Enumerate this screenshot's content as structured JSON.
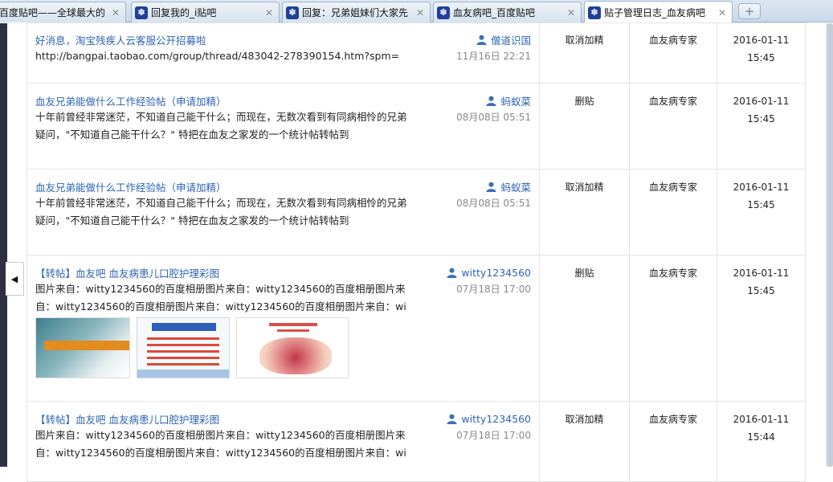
{
  "tabs": [
    {
      "title": "百度贴吧——全球最大的",
      "close": "✕",
      "icon": "none",
      "active": false
    },
    {
      "title": "回复我的_i贴吧",
      "close": "✕",
      "icon": "paw-icon",
      "active": false
    },
    {
      "title": "回复：兄弟姐妹们大家先",
      "close": "✕",
      "icon": "paw-icon",
      "active": false
    },
    {
      "title": "血友病吧_百度贴吧",
      "close": "✕",
      "icon": "paw-icon",
      "active": false
    },
    {
      "title": "贴子管理日志_血友病吧",
      "close": "✕",
      "icon": "paw-icon",
      "active": true
    }
  ],
  "new_tab_label": "+",
  "collapse_glyph": "◀",
  "user_icon": "user-icon",
  "rows": [
    {
      "title": "好消息，淘宝残疾人云客服公开招募啦",
      "author": "僧道识国",
      "excerpt": "http://bangpai.taobao.com/group/thread/483042-278390154.htm?spm=",
      "date": "11月16日 22:21",
      "operation": "取消加精",
      "operator": "血友病专家",
      "op_date": "2016-01-11",
      "op_time": "15:45"
    },
    {
      "title": "血友兄弟能做什么工作经验帖（申请加精）",
      "author": "蚂蚁菜",
      "excerpt": "十年前曾经非常迷茫，不知道自己能干什么；而现在，无数次看到有同病相怜的兄弟疑问，\"不知道自己能干什么？\" 特把在血友之家发的一个统计帖转帖到",
      "date": "08月08日 05:51",
      "operation": "删贴",
      "operator": "血友病专家",
      "op_date": "2016-01-11",
      "op_time": "15:45"
    },
    {
      "title": "血友兄弟能做什么工作经验帖（申请加精）",
      "author": "蚂蚁菜",
      "excerpt": "十年前曾经非常迷茫，不知道自己能干什么；而现在，无数次看到有同病相怜的兄弟疑问，\"不知道自己能干什么？\" 特把在血友之家发的一个统计帖转帖到",
      "date": "08月08日 05:51",
      "operation": "取消加精",
      "operator": "血友病专家",
      "op_date": "2016-01-11",
      "op_time": "15:45"
    },
    {
      "title": "【转帖】血友吧 血友病患儿口腔护理彩图",
      "author": "witty1234560",
      "excerpt": "图片来自：witty1234560的百度相册图片来自：witty1234560的百度相册图片来自：witty1234560的百度相册图片来自：witty1234560的百度相册图片来自：wi",
      "date": "07月18日 17:00",
      "operation": "删贴",
      "operator": "血友病专家",
      "op_date": "2016-01-11",
      "op_time": "15:45"
    },
    {
      "title": "【转帖】血友吧 血友病患儿口腔护理彩图",
      "author": "witty1234560",
      "excerpt": "图片来自：witty1234560的百度相册图片来自：witty1234560的百度相册图片来自：witty1234560的百度相册图片来自：witty1234560的百度相册图片来自：wi",
      "date": "07月18日 17:00",
      "operation": "取消加精",
      "operator": "血友病专家",
      "op_date": "2016-01-11",
      "op_time": "15:44"
    }
  ]
}
